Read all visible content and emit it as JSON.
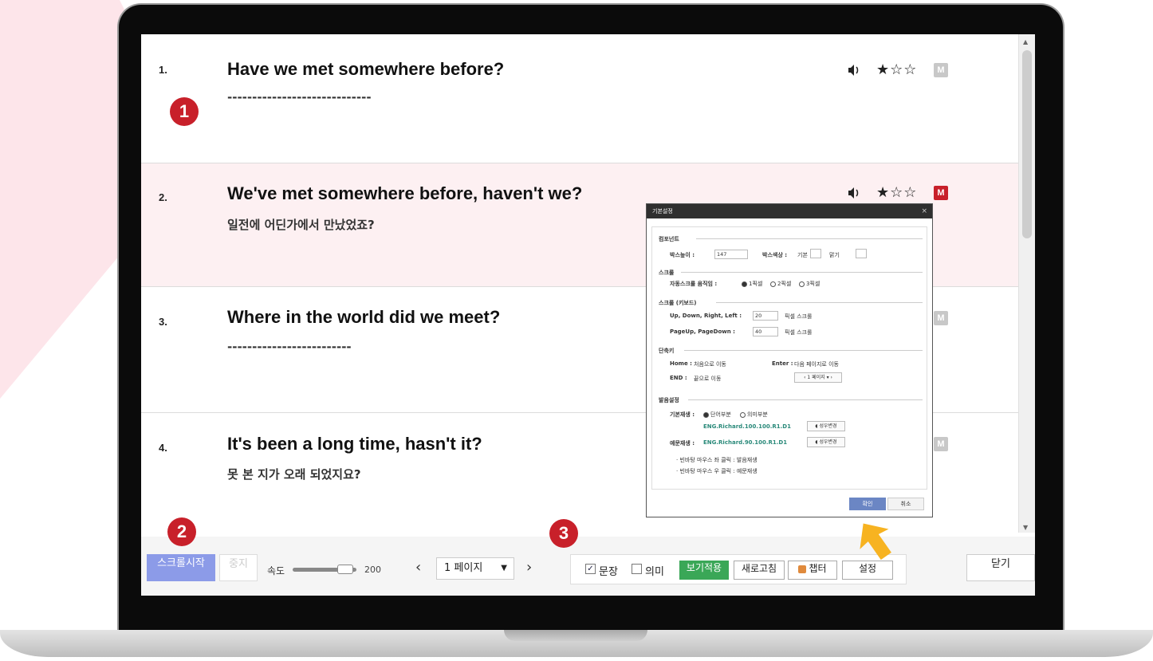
{
  "rows": [
    {
      "num": "1.",
      "sentence": "Have we met somewhere before?",
      "meaning": "-----------------------------",
      "stars": "★☆☆",
      "badge": "M"
    },
    {
      "num": "2.",
      "sentence": "We've met somewhere before, haven't we?",
      "meaning": "일전에 어딘가에서 만났었죠?",
      "stars": "★☆☆",
      "badge": "M"
    },
    {
      "num": "3.",
      "sentence": "Where in the world did we meet?",
      "meaning": "-------------------------",
      "stars": "★☆☆",
      "badge": "M"
    },
    {
      "num": "4.",
      "sentence": "It's been a long time, hasn't it?",
      "meaning": "못 본 지가 오래 되었지요?",
      "stars": "★☆☆",
      "badge": "M"
    }
  ],
  "callouts": {
    "one": "1",
    "two": "2",
    "three": "3"
  },
  "toolbar": {
    "start": "스크롤시작",
    "stop": "중지",
    "speed_label": "속도",
    "speed_value": "200",
    "speed_level": 0.85,
    "prev": "‹",
    "next": "›",
    "page": "1 페이지",
    "sentence_label": "문장",
    "meaning_label": "의미",
    "apply": "보기적용",
    "refresh": "새로고침",
    "chapter": "챕터",
    "settings": "설정",
    "close": "닫기"
  },
  "dialog": {
    "title": "기본설정",
    "close": "×",
    "component": "컴포넌트",
    "box_height_label": "박스높이 :",
    "box_height_value": "147",
    "box_color_label": "박스색상 :",
    "box_color_default": "기본",
    "box_color_light": "맑기",
    "scroll": "스크롤",
    "auto_scroll_label": "자동스크롤 움직임 :",
    "px1": "1픽셀",
    "px2": "2픽셀",
    "px3": "3픽셀",
    "scroll_kbd": "스크롤 (키보드)",
    "udrl_label": "Up, Down, Right, Left :",
    "udrl_value": "20",
    "pixel_scroll": "픽셀 스크롤",
    "pgud_label": "PageUp, PageDown :",
    "pgud_value": "40",
    "shortcut": "단축키",
    "home_key": "Home :",
    "home_desc": "처음으로 이동",
    "enter_key": "Enter :",
    "enter_desc": "다음 페이지로 이동",
    "end_key": "END :",
    "end_desc": "끝으로 이동",
    "mini_page": "1 페이지",
    "pron": "발음설정",
    "basic_play_label": "기본재생 :",
    "word_part": "단어부분",
    "meaning_part": "의미부분",
    "voice1": "ENG.Richard.100.100.R1.D1",
    "voice_change": "성우변경",
    "example_play_label": "예문재생 :",
    "voice2": "ENG.Richard.90.100.R1.D1",
    "note1": "빈바탕 마우스 좌 클릭 : 발음재생",
    "note2": "빈바탕 마우스 우 클릭 : 예문재생",
    "ok": "확인",
    "cancel": "취소"
  }
}
